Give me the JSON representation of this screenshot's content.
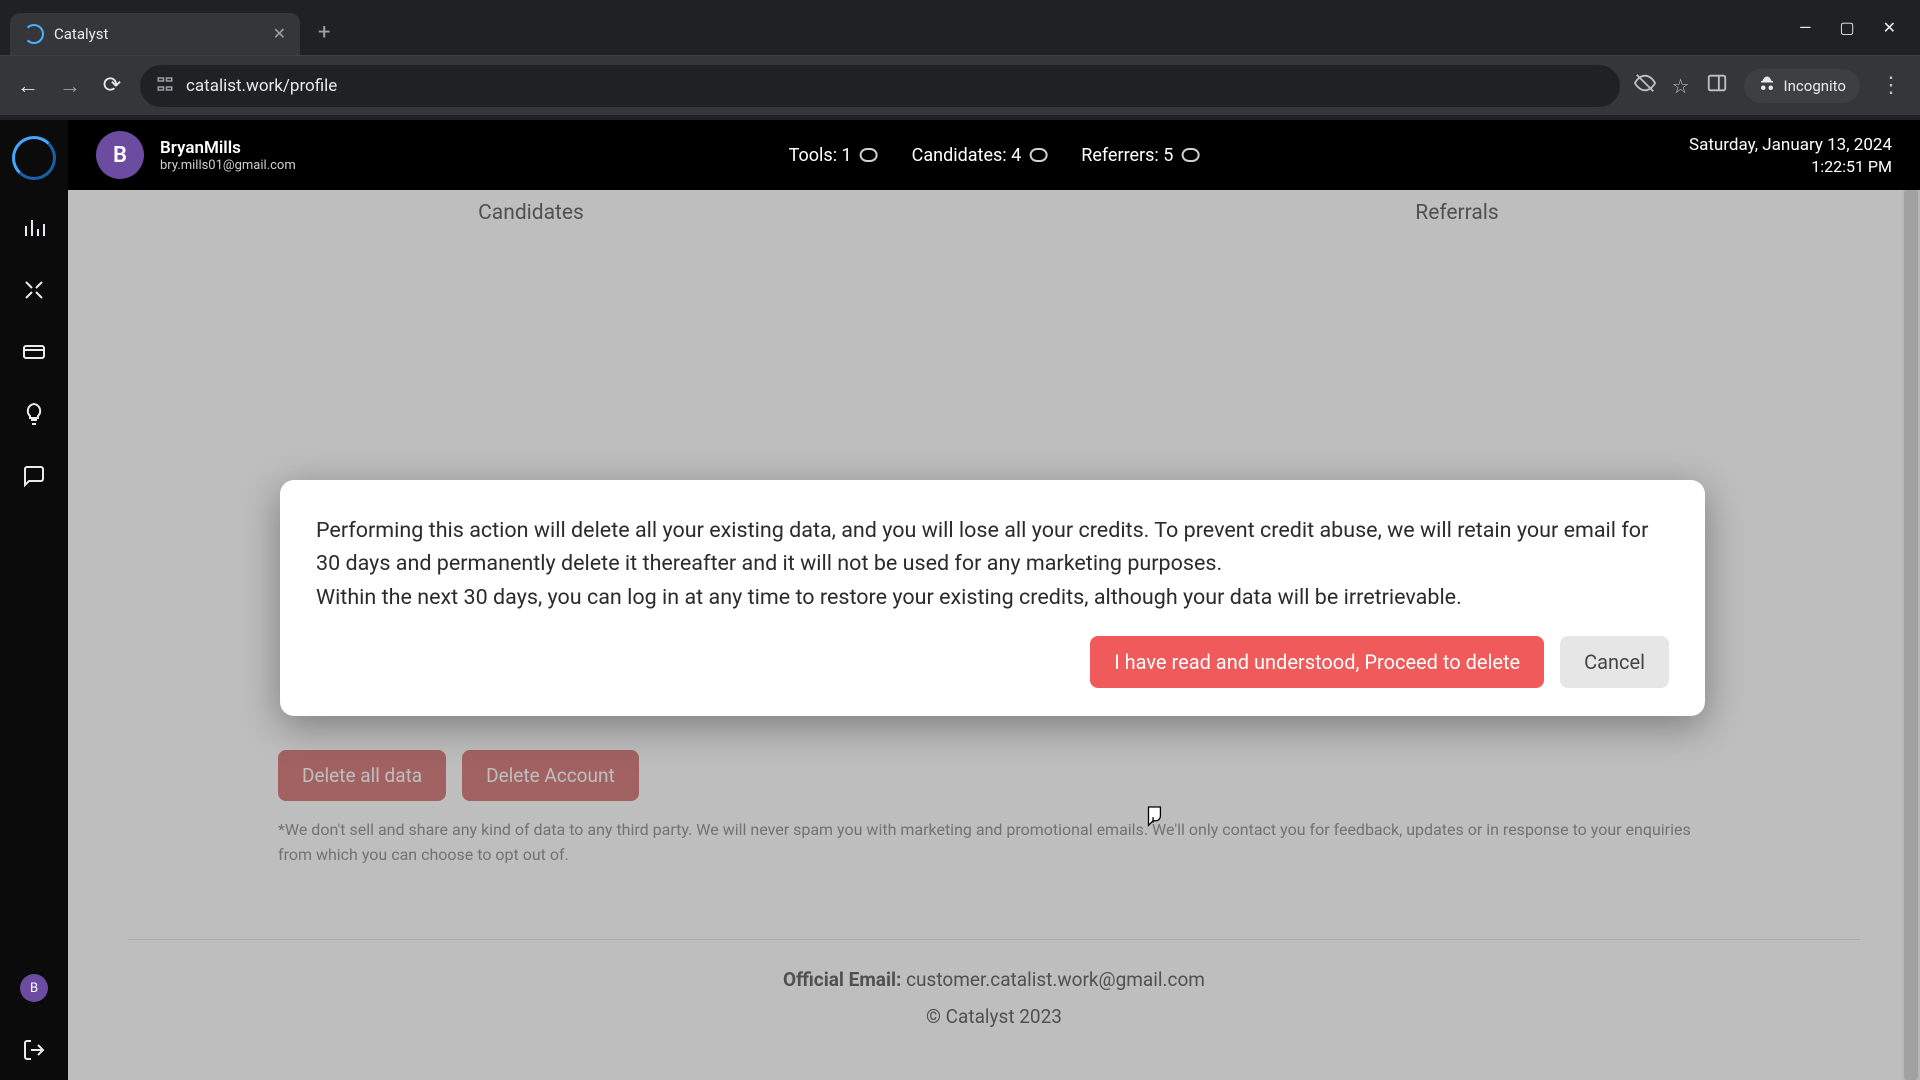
{
  "browser": {
    "tab_title": "Catalyst",
    "url": "catalist.work/profile",
    "incognito_label": "Incognito"
  },
  "header": {
    "avatar_initial": "B",
    "username": "BryanMills",
    "email": "bry.mills01@gmail.com",
    "stats": {
      "tools_label": "Tools: 1",
      "candidates_label": "Candidates: 4",
      "referrers_label": "Referrers: 5"
    },
    "date": "Saturday, January 13, 2024",
    "time": "1:22:51 PM"
  },
  "tabs": {
    "candidates": "Candidates",
    "referrals": "Referrals"
  },
  "danger_buttons": {
    "delete_all_data": "Delete all data",
    "delete_account": "Delete Account"
  },
  "disclaimer": "*We don't sell and share any kind of data to any third party. We will never spam you with marketing and promotional emails. We'll only contact you for feedback, updates or in response to your enquiries from which you can choose to opt out of.",
  "footer": {
    "email_label": "Official Email:",
    "email_value": "customer.catalist.work@gmail.com",
    "copyright": "© Catalyst 2023"
  },
  "modal": {
    "paragraph1": "Performing this action will delete all your existing data, and you will lose all your credits. To prevent credit abuse, we will retain your email for 30 days and permanently delete it thereafter and it will not be used for any marketing purposes.",
    "paragraph2": "Within the next 30 days, you can log in at any time to restore your existing credits, although your data will be irretrievable.",
    "proceed_label": "I have read and understood, Proceed to delete",
    "cancel_label": "Cancel"
  },
  "rail": {
    "avatar_initial": "B"
  }
}
